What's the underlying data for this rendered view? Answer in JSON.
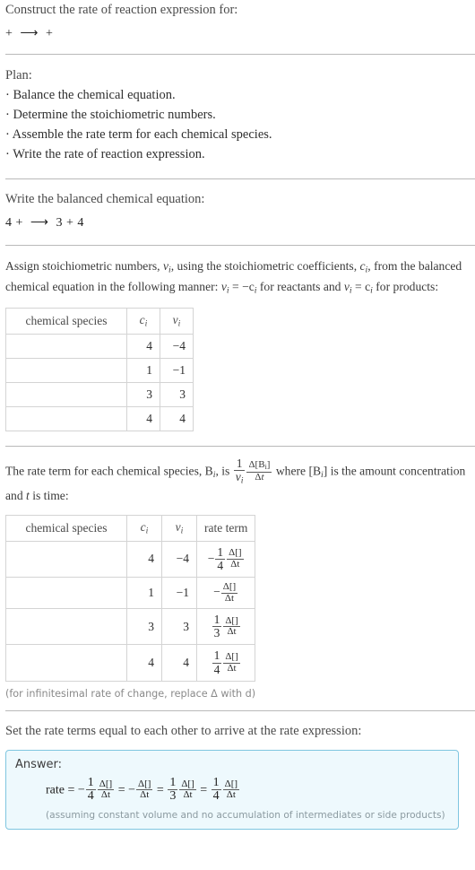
{
  "prompt": {
    "title": "Construct the rate of reaction expression for:",
    "equation": "+  ⟶  +"
  },
  "plan": {
    "heading": "Plan:",
    "items": [
      "· Balance the chemical equation.",
      "· Determine the stoichiometric numbers.",
      "· Assemble the rate term for each chemical species.",
      "· Write the rate of reaction expression."
    ]
  },
  "balanced": {
    "heading": "Write the balanced chemical equation:",
    "equation": "4 +  ⟶  3 + 4"
  },
  "stoich": {
    "paragraph_1": "Assign stoichiometric numbers, ",
    "paragraph_2": ", using the stoichiometric coefficients, ",
    "paragraph_3": ", from the balanced chemical equation in the following manner: ",
    "paragraph_4": " for reactants and ",
    "paragraph_5": " for products:",
    "symbol_nu": "ν",
    "symbol_c": "c",
    "sub_i": "i",
    "rel_reactants": "= −c",
    "rel_products": "= c",
    "table": {
      "headers": [
        "chemical species",
        "c",
        "ν"
      ],
      "header_sub": "i",
      "rows": [
        {
          "species": "",
          "c": "4",
          "nu": "−4"
        },
        {
          "species": "",
          "c": "1",
          "nu": "−1"
        },
        {
          "species": "",
          "c": "3",
          "nu": "3"
        },
        {
          "species": "",
          "c": "4",
          "nu": "4"
        }
      ]
    }
  },
  "rate_term": {
    "para_a": "The rate term for each chemical species, B",
    "para_b": ", is ",
    "para_c": " where [B",
    "para_d": "] is the amount concentration and ",
    "para_e": " is time:",
    "t_symbol": "t",
    "frac_num_1": "1",
    "frac_den_nu": "ν",
    "frac_num_delta": "Δ[B",
    "frac_num_delta_close": "]",
    "frac_den_dt": "Δt",
    "table": {
      "headers": [
        "chemical species",
        "c",
        "ν",
        "rate term"
      ],
      "header_sub": "i",
      "rows": [
        {
          "species": "",
          "c": "4",
          "nu": "−4",
          "sign": "−",
          "coef_num": "1",
          "coef_den": "4",
          "delta_num": "Δ[]",
          "delta_den": "Δt"
        },
        {
          "species": "",
          "c": "1",
          "nu": "−1",
          "sign": "−",
          "coef_num": "",
          "coef_den": "",
          "delta_num": "Δ[]",
          "delta_den": "Δt"
        },
        {
          "species": "",
          "c": "3",
          "nu": "3",
          "sign": "",
          "coef_num": "1",
          "coef_den": "3",
          "delta_num": "Δ[]",
          "delta_den": "Δt"
        },
        {
          "species": "",
          "c": "4",
          "nu": "4",
          "sign": "",
          "coef_num": "1",
          "coef_den": "4",
          "delta_num": "Δ[]",
          "delta_den": "Δt"
        }
      ]
    },
    "footnote": "(for infinitesimal rate of change, replace Δ with d)",
    "footnote_d": "d"
  },
  "final": {
    "heading": "Set the rate terms equal to each other to arrive at the rate expression:",
    "answer_label": "Answer:",
    "rate_word": "rate",
    "equals": "=",
    "terms": [
      {
        "sign": "−",
        "coef_num": "1",
        "coef_den": "4",
        "delta_num": "Δ[]",
        "delta_den": "Δt"
      },
      {
        "sign": "−",
        "coef_num": "",
        "coef_den": "",
        "delta_num": "Δ[]",
        "delta_den": "Δt"
      },
      {
        "sign": "",
        "coef_num": "1",
        "coef_den": "3",
        "delta_num": "Δ[]",
        "delta_den": "Δt"
      },
      {
        "sign": "",
        "coef_num": "1",
        "coef_den": "4",
        "delta_num": "Δ[]",
        "delta_den": "Δt"
      }
    ],
    "assumption": "(assuming constant volume and no accumulation of intermediates or side products)"
  },
  "colors": {
    "answer_bg": "#eef9fd",
    "answer_border": "#7fc6e0",
    "rule": "#b9b9b9",
    "table_border": "#d4d4d4"
  }
}
